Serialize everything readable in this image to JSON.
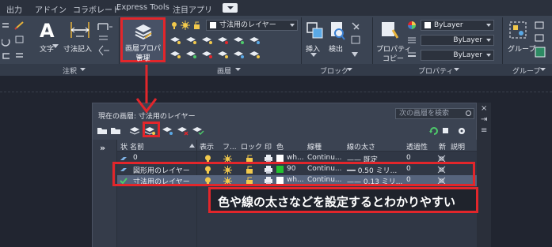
{
  "tabs": [
    "出力",
    "アドイン",
    "コラボレート",
    "Express Tools",
    "注目アプリ"
  ],
  "ribbon": {
    "buttons": {
      "text": "文字",
      "dimension": "寸法記入",
      "layer_props_line1": "画層プロパティ",
      "layer_props_line2": "管理",
      "insert": "挿入",
      "detect": "検出",
      "props_copy_line1": "プロパティ",
      "props_copy_line2": "コピー",
      "group": "グループ"
    },
    "layer_dropdown": "寸法用のレイヤー",
    "bylayer_color": "ByLayer",
    "bylayer_linetype": "ByLayer",
    "bylayer_lineweight": "ByLayer",
    "panels": {
      "annotation": "注釈",
      "layers": "画層",
      "block": "ブロック",
      "properties": "プロパティ",
      "groups": "グループ"
    }
  },
  "palette": {
    "current_layer": "現在の画層: 寸法用のレイヤー",
    "search_placeholder": "次の画層を検索",
    "expand_symbol": "»",
    "side_close": "×",
    "side_pin": "⇥",
    "side_menu": "≡",
    "columns": {
      "status": "状",
      "name": "名前",
      "on": "表示",
      "freeze": "フ...",
      "lock": "ロック",
      "plot": "印",
      "color": "色",
      "linetype": "線種",
      "lineweight": "線の太さ",
      "transparency": "透過性",
      "new": "新",
      "description": "説明"
    },
    "rows": [
      {
        "name": "0",
        "color_name": "wh...",
        "color_hex": "#ffffff",
        "linetype": "Continu...",
        "lineweight": "—— 既定",
        "transparency": "0"
      },
      {
        "name": "図形用のレイヤー",
        "color_name": "90",
        "color_hex": "#22c32e",
        "linetype": "Continu...",
        "lineweight": "━━ 0.50 ミリ...",
        "transparency": "0"
      },
      {
        "name": "寸法用のレイヤー",
        "color_name": "wh...",
        "color_hex": "#ffffff",
        "linetype": "Continu...",
        "lineweight": "—— 0.13 ミリ...",
        "transparency": "0"
      }
    ]
  },
  "annotation_text": "色や線の太さなどを設定するとわかりやすい",
  "colors": {
    "highlight": "#e2262b",
    "ribbon_bg": "#3b4453",
    "workspace_bg": "#212530",
    "selected_row": "#56647d"
  }
}
